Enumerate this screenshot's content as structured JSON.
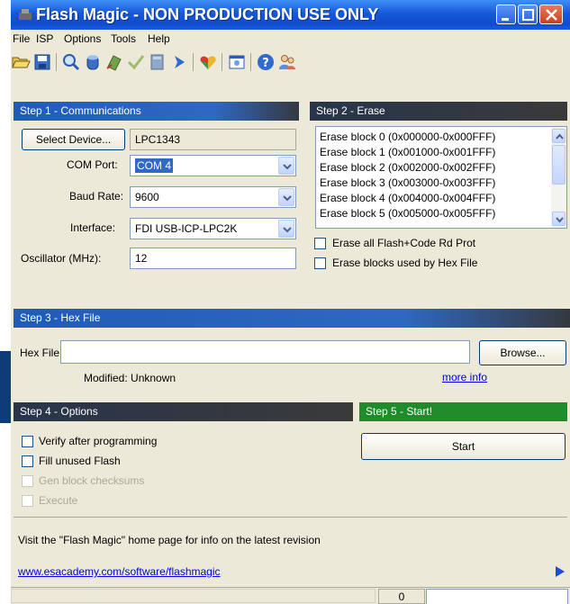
{
  "window": {
    "title": "Flash Magic - NON PRODUCTION USE ONLY"
  },
  "menu": [
    "File",
    "ISP",
    "Options",
    "Tools",
    "Help"
  ],
  "toolbar_icons": [
    "open-icon",
    "save-icon",
    "search-icon",
    "database-icon",
    "erase-icon",
    "check-icon",
    "book-icon",
    "run-icon",
    "heart-icon",
    "terminal-icon",
    "help-icon",
    "users-icon"
  ],
  "step1": {
    "header": "Step 1 - Communications",
    "select_device_label": "Select Device...",
    "device": "LPC1343",
    "com_port_label": "COM Port:",
    "com_port": "COM 4",
    "baud_rate_label": "Baud Rate:",
    "baud_rate": "9600",
    "interface_label": "Interface:",
    "interface": "FDI USB-ICP-LPC2K",
    "oscillator_label": "Oscillator (MHz):",
    "oscillator": "12"
  },
  "step2": {
    "header": "Step 2 - Erase",
    "blocks": [
      "Erase block 0 (0x000000-0x000FFF)",
      "Erase block 1 (0x001000-0x001FFF)",
      "Erase block 2 (0x002000-0x002FFF)",
      "Erase block 3 (0x003000-0x003FFF)",
      "Erase block 4 (0x004000-0x004FFF)",
      "Erase block 5 (0x005000-0x005FFF)"
    ],
    "erase_all_label": "Erase all Flash+Code Rd Prot",
    "erase_hex_label": "Erase blocks used by Hex File"
  },
  "step3": {
    "header": "Step 3 - Hex File",
    "hex_file_label": "Hex File:",
    "hex_file": "",
    "browse_label": "Browse...",
    "modified": "Modified: Unknown",
    "more_info": "more info"
  },
  "step4": {
    "header": "Step 4 - Options",
    "verify_label": "Verify after programming",
    "fill_label": "Fill unused Flash",
    "gen_checksums_label": "Gen block checksums",
    "execute_label": "Execute"
  },
  "step5": {
    "header": "Step 5 - Start!",
    "start_label": "Start"
  },
  "footer": {
    "info": "Visit the \"Flash Magic\" home page for info on the latest revision",
    "link": "www.esacademy.com/software/flashmagic"
  },
  "status": {
    "progress": "0"
  },
  "colors": {
    "title_blue": "#0f4ccc",
    "header_blue": "#1f5cb8",
    "header_green": "#1f8b2b",
    "link": "#0000ee"
  }
}
